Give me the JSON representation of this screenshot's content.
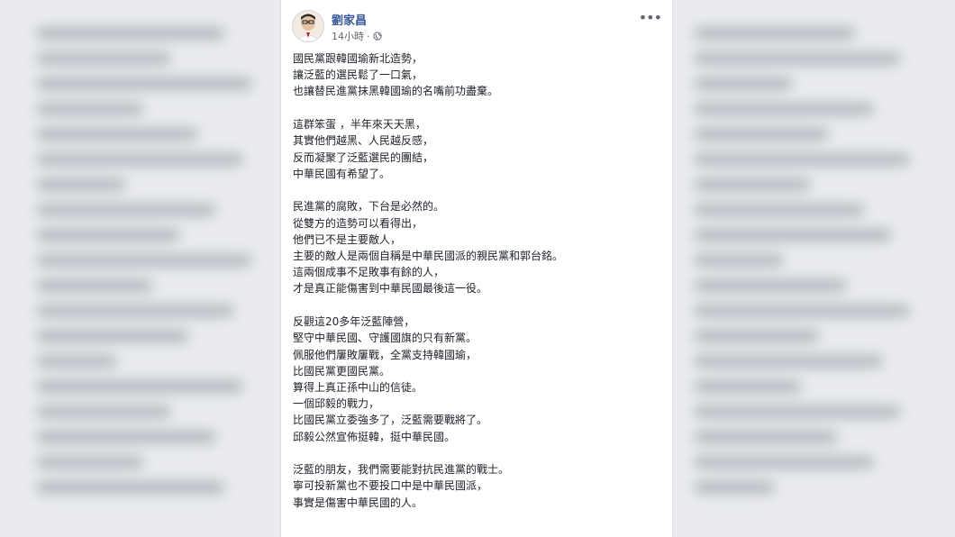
{
  "post": {
    "author": "劉家昌",
    "time": "14小時",
    "separator": "·",
    "more_icon": "•••",
    "paragraphs": [
      [
        "國民黨跟韓國瑜新北造勢，",
        "讓泛藍的選民鬆了一口氣，",
        "也讓替民進黨抹黑韓國瑜的名嘴前功盡棄。"
      ],
      [
        "這群笨蛋 ，半年來天天黑，",
        "其實他們越黑、人民越反感，",
        "反而凝聚了泛藍選民的團結，",
        "中華民國有希望了。"
      ],
      [
        "民進黨的腐敗，下台是必然的。",
        "從雙方的造勢可以看得出，",
        "他們已不是主要敵人，",
        "主要的敵人是兩個自稱是中華民國派的親民黨和郭台銘。",
        "這兩個成事不足敗事有餘的人，",
        "才是真正能傷害到中華民國最後這一役。"
      ],
      [
        "反觀這20多年泛藍陣營，",
        "堅守中華民國、守護國旗的只有新黨。",
        "佩服他們屢敗屢戰，全黨支持韓國瑜，",
        "比國民黨更國民黨。",
        "算得上真正孫中山的信徒。",
        "一個邱毅的戰力，",
        "比國民黨立委強多了，泛藍需要戰將了。",
        "邱毅公然宣佈挺韓，挺中華民國。"
      ],
      [
        "泛藍的朋友，我們需要能對抗民進黨的戰士。",
        "寧可投新黨也不要投口中是中華民國派，",
        "事實是傷害中華民國的人。"
      ]
    ]
  }
}
